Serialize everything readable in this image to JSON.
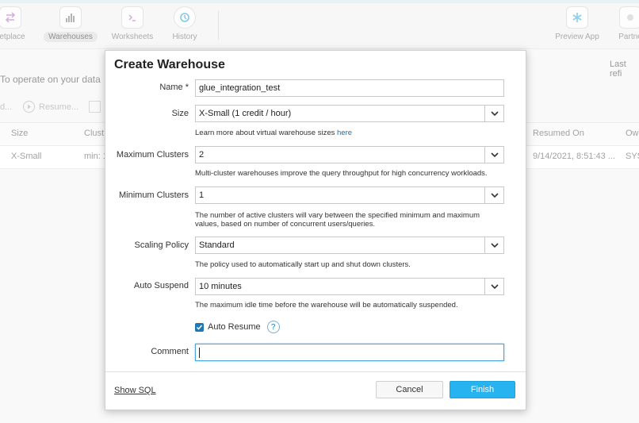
{
  "nav": {
    "items": [
      {
        "label": "ketplace",
        "icon": "marketplace-icon"
      },
      {
        "label": "Warehouses",
        "icon": "warehouses-icon",
        "active": true
      },
      {
        "label": "Worksheets",
        "icon": "worksheets-icon"
      },
      {
        "label": "History",
        "icon": "history-icon"
      },
      {
        "label": "Preview App",
        "icon": "snowflake-icon"
      },
      {
        "label": "Partne",
        "icon": "partner-icon"
      }
    ]
  },
  "background": {
    "info_text": "To operate on your data",
    "last_refreshed": "Last refi",
    "toolbar": {
      "left_fragment": "d...",
      "resume_label": "Resume..."
    },
    "table": {
      "headers": [
        "Size",
        "Clust",
        "Resumed On",
        "Ow"
      ],
      "row": [
        "X-Small",
        "min: 1",
        "9/14/2021, 8:51:43 ...",
        "SYS"
      ]
    }
  },
  "dialog": {
    "title": "Create Warehouse",
    "name": {
      "label": "Name",
      "required_mark": "*",
      "value": "glue_integration_test"
    },
    "size": {
      "label": "Size",
      "value": "X-Small  (1 credit / hour)",
      "help_text": "Learn more about virtual warehouse sizes",
      "help_link": "here"
    },
    "max_clusters": {
      "label": "Maximum Clusters",
      "value": "2",
      "help_text": "Multi-cluster warehouses improve the query throughput for high concurrency workloads."
    },
    "min_clusters": {
      "label": "Minimum Clusters",
      "value": "1",
      "help_line1": "The number of active clusters will vary between the specified minimum and maximum",
      "help_line2": "values, based on number of concurrent users/queries."
    },
    "scaling_policy": {
      "label": "Scaling Policy",
      "value": "Standard",
      "help_text": "The policy used to automatically start up and shut down clusters."
    },
    "auto_suspend": {
      "label": "Auto Suspend",
      "value": "10 minutes",
      "help_text": "The maximum idle time before the warehouse will be automatically suspended."
    },
    "auto_resume": {
      "label": "Auto Resume",
      "checked": true,
      "help_icon": "?"
    },
    "comment": {
      "label": "Comment",
      "value": ""
    },
    "show_sql": "Show SQL",
    "cancel": "Cancel",
    "finish": "Finish"
  },
  "colors": {
    "accent": "#26b3f0",
    "link": "#1a6fb5",
    "checkbox": "#1f78b4"
  }
}
